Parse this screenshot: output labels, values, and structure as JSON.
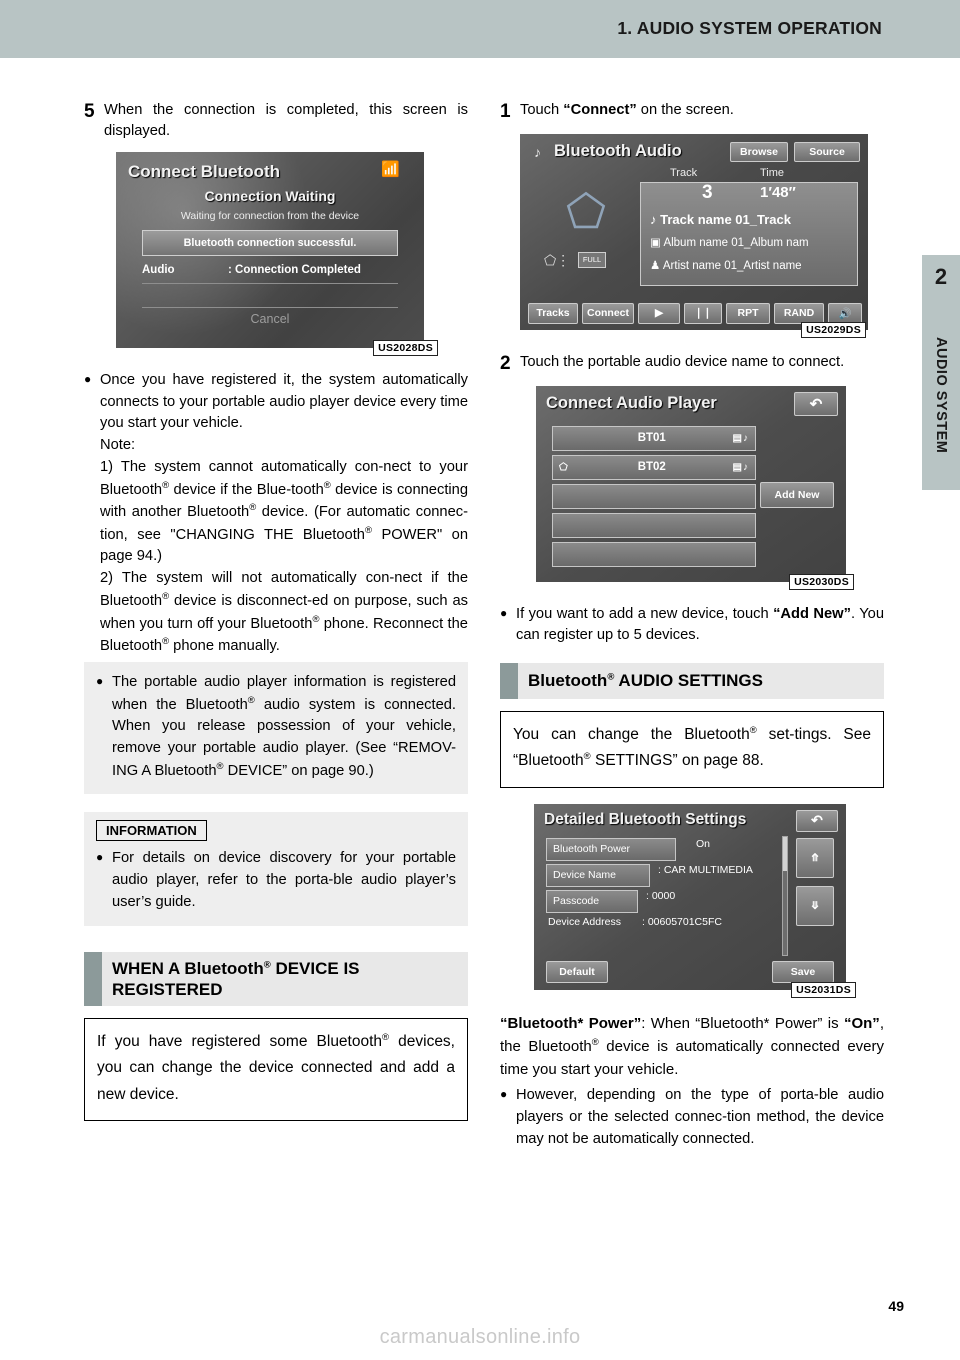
{
  "header": {
    "title": "1. AUDIO SYSTEM OPERATION"
  },
  "side_tab": {
    "number": "2",
    "label": "AUDIO SYSTEM"
  },
  "page_number": "49",
  "watermark": "carmanualsonline.info",
  "left": {
    "step5": {
      "num": "5",
      "text": "When the connection is completed, this screen is displayed."
    },
    "shot1": {
      "id": "US2028DS",
      "title": "Connect Bluetooth",
      "icon": "bluetooth-signal-icon",
      "subtitle": "Connection Waiting",
      "subtitle2": "Waiting for connection from the device",
      "status_bar": "Bluetooth connection successful.",
      "row_key": "Audio",
      "row_val": ": Connection Completed",
      "cancel": "Cancel"
    },
    "bullet1": {
      "line1": "Once you have registered it, the system automatically connects to your portable audio player device every time you start your vehicle.",
      "note_label": "Note:",
      "note1_a": "1) The system cannot automatically con-nect to your Bluetooth",
      "note1_b": " device if the Blue-tooth",
      "note1_c": " device is connecting with another Bluetooth",
      "note1_d": " device. (For automatic connec-tion, see \"CHANGING THE Bluetooth",
      "note1_e": " POWER\" on page 94.)",
      "note2_a": "2) The system will not automatically con-nect if the Bluetooth",
      "note2_b": " device is disconnect-ed on purpose, such as when you turn off your Bluetooth",
      "note2_c": " phone. Reconnect the Bluetooth",
      "note2_d": " phone manually."
    },
    "grey_bullet": {
      "a": "The portable audio player information is registered when the Bluetooth",
      "b": " audio system is connected. When you release possession of your vehicle, remove your portable audio player. (See “REMOV-ING A Bluetooth",
      "c": " DEVICE” on page 90.)"
    },
    "information": {
      "heading": "INFORMATION",
      "bullet": "For details on device discovery for your portable audio player, refer to the porta-ble audio player’s user’s guide."
    },
    "section": {
      "title_a": "WHEN A Bluetooth",
      "title_b": " DEVICE IS REGISTERED",
      "body_a": "If you have registered some Bluetooth",
      "body_b": " devices, you can change the device connected and add a new device."
    }
  },
  "right": {
    "step1": {
      "num": "1",
      "text_a": "Touch ",
      "text_b": "“Connect”",
      "text_c": " on the screen."
    },
    "shot2": {
      "id": "US2029DS",
      "title": "Bluetooth Audio",
      "note_icon": "music-note-icon",
      "browse": "Browse",
      "source": "Source",
      "track_label": "Track",
      "time_label": "Time",
      "track_no": "3",
      "time_value": "1′48″",
      "line1": "Track name 01_Track",
      "line2": "Album name 01_Album nam",
      "line3": "Artist name 01_Artist name",
      "rand_box": "FULL",
      "buttons": [
        "Tracks",
        "Connect",
        "▶",
        "❘❘",
        "RPT",
        "RAND",
        "🔊"
      ]
    },
    "step2": {
      "num": "2",
      "text": "Touch the portable audio device name to connect."
    },
    "shot3": {
      "id": "US2030DS",
      "title": "Connect Audio Player",
      "back_icon": "return-arrow-icon",
      "items": [
        "BT01",
        "BT02",
        "",
        "",
        ""
      ],
      "add_new": "Add New"
    },
    "bullet_add": {
      "a": "If you want to add a new device, touch ",
      "b": "“Add New”",
      "c": ". You can register up to 5 devices."
    },
    "section": {
      "title_a": "Bluetooth",
      "title_b": " AUDIO SETTINGS",
      "body_a": "You can change the Bluetooth",
      "body_b": " set-tings. See “Bluetooth",
      "body_c": " SETTINGS” on page 88."
    },
    "shot4": {
      "id": "US2031DS",
      "title": "Detailed Bluetooth Settings",
      "back_icon": "return-arrow-icon",
      "rows": [
        {
          "key": "Bluetooth Power",
          "val": "On"
        },
        {
          "key": "Device Name",
          "val": ": CAR MULTIMEDIA"
        },
        {
          "key": "Passcode",
          "val": ": 0000"
        },
        {
          "key": "Device Address",
          "val": ": 00605701C5FC"
        }
      ],
      "up_icon": "chevron-up-icon",
      "down_icon": "chevron-down-icon",
      "default_btn": "Default",
      "save_btn": "Save"
    },
    "power_text": {
      "a": "“Bluetooth* Power”",
      "b": ": When “Bluetooth* Power” is ",
      "c": "“On”",
      "d": ", the Bluetooth",
      "e": " device is automatically connected every time you start your vehicle."
    },
    "bullet_however": "However, depending on the type of porta-ble audio players or the selected connec-tion method, the device may not be automatically connected."
  }
}
